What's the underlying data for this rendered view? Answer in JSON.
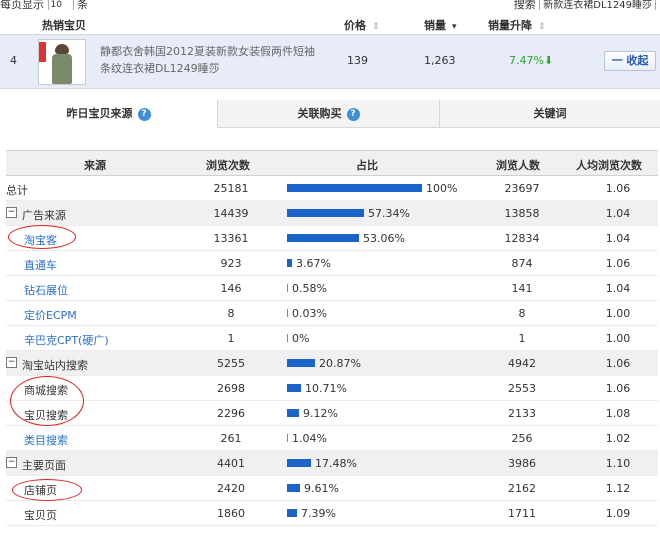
{
  "topbar": {
    "per_page_label": "每页显示",
    "per_page_value": "10",
    "per_page_unit": "条",
    "search_label": "搜索",
    "search_value": "新款连衣裙DL1249睡莎"
  },
  "product_table": {
    "headers": {
      "hot_item": "热销宝贝",
      "price": "价格",
      "sales": "销量",
      "sales_rise": "销量升降"
    },
    "row": {
      "rank": "4",
      "name": "静都衣舍韩国2012夏装新款女装假两件短袖条纹连衣裙DL1249睡莎",
      "price": "139",
      "sales": "1,263",
      "rise": "7.47%",
      "collapse_label": "一 收起"
    }
  },
  "tabs": [
    {
      "label": "昨日宝贝来源",
      "active": true
    },
    {
      "label": "关联购买",
      "active": false
    },
    {
      "label": "关键词",
      "active": false
    }
  ],
  "source_table": {
    "headers": {
      "source": "来源",
      "views": "浏览次数",
      "share": "占比",
      "visitors": "浏览人数",
      "avg_views": "人均浏览次数"
    },
    "rows": [
      {
        "name": "总计",
        "views": "25181",
        "pct": "100%",
        "share": 100.0,
        "visitors": "23697",
        "avg": "1.06",
        "kind": "total"
      },
      {
        "name": "广告来源",
        "views": "14439",
        "pct": "57.34%",
        "share": 57.34,
        "visitors": "13858",
        "avg": "1.04",
        "kind": "group",
        "toggle": "−"
      },
      {
        "name": "淘宝客",
        "views": "13361",
        "pct": "53.06%",
        "share": 53.06,
        "visitors": "12834",
        "avg": "1.04",
        "kind": "link"
      },
      {
        "name": "直通车",
        "views": "923",
        "pct": "3.67%",
        "share": 3.67,
        "visitors": "874",
        "avg": "1.06",
        "kind": "link"
      },
      {
        "name": "钻石展位",
        "views": "146",
        "pct": "0.58%",
        "share": 0.58,
        "visitors": "141",
        "avg": "1.04",
        "kind": "link"
      },
      {
        "name": "定价ECPM",
        "views": "8",
        "pct": "0.03%",
        "share": 0.03,
        "visitors": "8",
        "avg": "1.00",
        "kind": "link"
      },
      {
        "name": "辛巴克CPT(硬广)",
        "views": "1",
        "pct": "0%",
        "share": 0.0,
        "visitors": "1",
        "avg": "1.00",
        "kind": "link"
      },
      {
        "name": "淘宝站内搜索",
        "views": "5255",
        "pct": "20.87%",
        "share": 20.87,
        "visitors": "4942",
        "avg": "1.06",
        "kind": "group",
        "toggle": "−"
      },
      {
        "name": "商城搜索",
        "views": "2698",
        "pct": "10.71%",
        "share": 10.71,
        "visitors": "2553",
        "avg": "1.06",
        "kind": "plain"
      },
      {
        "name": "宝贝搜索",
        "views": "2296",
        "pct": "9.12%",
        "share": 9.12,
        "visitors": "2133",
        "avg": "1.08",
        "kind": "plain"
      },
      {
        "name": "类目搜索",
        "views": "261",
        "pct": "1.04%",
        "share": 1.04,
        "visitors": "256",
        "avg": "1.02",
        "kind": "link"
      },
      {
        "name": "主要页面",
        "views": "4401",
        "pct": "17.48%",
        "share": 17.48,
        "visitors": "3986",
        "avg": "1.10",
        "kind": "group",
        "toggle": "−"
      },
      {
        "name": "店铺页",
        "views": "2420",
        "pct": "9.61%",
        "share": 9.61,
        "visitors": "2162",
        "avg": "1.12",
        "kind": "plain"
      },
      {
        "name": "宝贝页",
        "views": "1860",
        "pct": "7.39%",
        "share": 7.39,
        "visitors": "1711",
        "avg": "1.09",
        "kind": "plain"
      }
    ]
  },
  "colors": {
    "bar": "#1a63c9",
    "link": "#2a6fc9",
    "rise": "#2aa52a",
    "annotation": "#e02020",
    "selected_row": "#e8ecf8"
  }
}
